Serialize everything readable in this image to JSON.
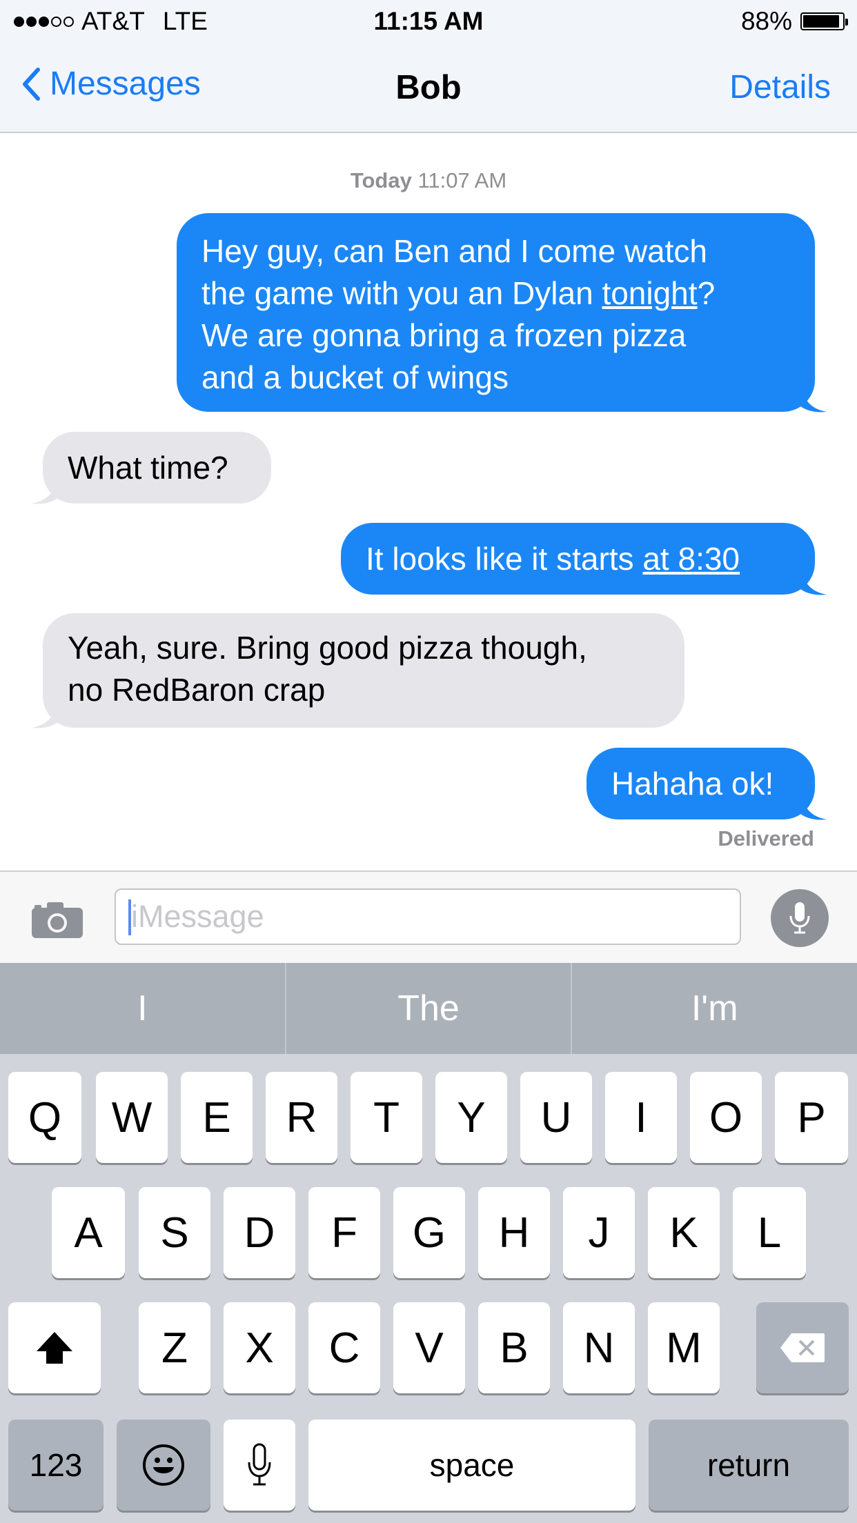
{
  "status_bar": {
    "carrier": "AT&T",
    "network": "LTE",
    "time": "11:15 AM",
    "battery": "88%",
    "battery_level": 0.88,
    "signal_bars_filled": 3,
    "signal_bars_total": 5
  },
  "nav": {
    "back_label": "Messages",
    "title": "Bob",
    "details_label": "Details"
  },
  "conversation": {
    "timestamp_day": "Today",
    "timestamp_time": "11:07 AM",
    "messages": [
      {
        "direction": "outgoing",
        "lines": [
          "Hey guy, can Ben and I come watch",
          "the game with you an Dylan ",
          "tonight",
          "?",
          "We are gonna bring a frozen pizza",
          "and a bucket of wings"
        ]
      },
      {
        "direction": "incoming",
        "text": "What time?"
      },
      {
        "direction": "outgoing",
        "prefix": "It looks like it starts ",
        "link": "at 8:30"
      },
      {
        "direction": "incoming",
        "lines": [
          "Yeah, sure. Bring good pizza though,",
          "no RedBaron crap"
        ]
      },
      {
        "direction": "outgoing",
        "text": "Hahaha ok!"
      }
    ],
    "delivered_label": "Delivered"
  },
  "input_bar": {
    "placeholder": "iMessage",
    "camera_icon": "camera-icon",
    "mic_icon": "microphone-icon"
  },
  "keyboard": {
    "predictions": [
      "I",
      "The",
      "I'm"
    ],
    "row1": [
      "Q",
      "W",
      "E",
      "R",
      "T",
      "Y",
      "U",
      "I",
      "O",
      "P"
    ],
    "row2": [
      "A",
      "S",
      "D",
      "F",
      "G",
      "H",
      "J",
      "K",
      "L"
    ],
    "row3": [
      "Z",
      "X",
      "C",
      "V",
      "B",
      "N",
      "M"
    ],
    "numbers_key": "123",
    "space_key": "space",
    "return_key": "return",
    "shift_icon": "shift-icon",
    "delete_icon": "delete-icon",
    "emoji_icon": "emoji-icon",
    "dictation_icon": "microphone-icon"
  },
  "colors": {
    "accent": "#1b7cf5",
    "outgoing_bubble": "#1b87f6",
    "incoming_bubble": "#e5e5ea"
  }
}
